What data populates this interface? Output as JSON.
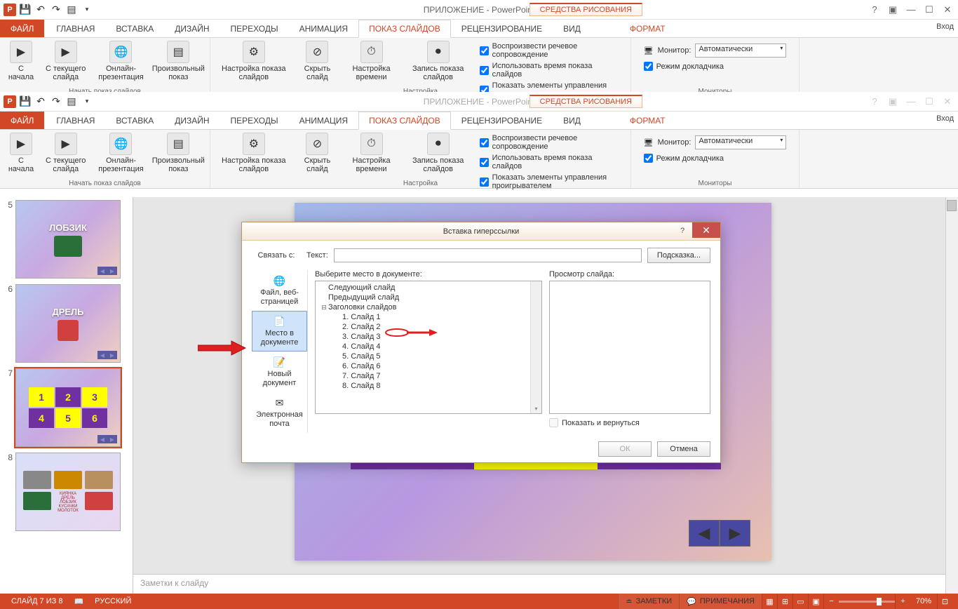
{
  "app_title": "ПРИЛОЖЕНИЕ  - PowerPoint",
  "drawing_tools": "СРЕДСТВА РИСОВАНИЯ",
  "sign_in": "Вход",
  "tabs": {
    "file": "ФАЙЛ",
    "home": "ГЛАВНАЯ",
    "insert": "ВСТАВКА",
    "design": "ДИЗАЙН",
    "transitions": "ПЕРЕХОДЫ",
    "animations": "АНИМАЦИЯ",
    "slideshow": "ПОКАЗ СЛАЙДОВ",
    "review": "РЕЦЕНЗИРОВАНИЕ",
    "view": "ВИД",
    "format": "ФОРМАТ"
  },
  "ribbon": {
    "from_start": "С начала",
    "from_current": "С текущего слайда",
    "online": "Онлайн-презентация",
    "custom": "Произвольный показ",
    "group_start": "Начать показ слайдов",
    "setup": "Настройка показа слайдов",
    "hide": "Скрыть слайд",
    "timing": "Настройка времени",
    "record": "Запись показа слайдов",
    "chk_narration": "Воспроизвести речевое сопровождение",
    "chk_timings": "Использовать время показа слайдов",
    "chk_controls": "Показать элементы управления проигрывателем",
    "group_setup": "Настройка",
    "monitor_label": "Монитор:",
    "monitor_value": "Автоматически",
    "presenter_view": "Режим докладчика",
    "group_monitors": "Мониторы"
  },
  "thumbs": {
    "n5": "5",
    "t5": "ЛОБЗИК",
    "n6": "6",
    "t6": "ДРЕЛЬ",
    "n7": "7",
    "n8": "8",
    "grid": [
      "1",
      "2",
      "3",
      "4",
      "5",
      "6"
    ]
  },
  "notes_placeholder": "Заметки к слайду",
  "dialog": {
    "title": "Вставка гиперссылки",
    "link_to": "Связать с:",
    "text_label": "Текст:",
    "hint_btn": "Подсказка...",
    "left": {
      "file": "Файл, веб-страницей",
      "place": "Место в документе",
      "new": "Новый документ",
      "email": "Электронная почта"
    },
    "select_label": "Выберите место в документе:",
    "preview_label": "Просмотр слайда:",
    "tree": {
      "next": "Следующий слайд",
      "prev": "Предыдущий слайд",
      "titles": "Заголовки слайдов",
      "s1": "1. Слайд 1",
      "s2": "2. Слайд 2",
      "s3": "3. Слайд 3",
      "s4": "4. Слайд 4",
      "s5": "5. Слайд 5",
      "s6": "6. Слайд 6",
      "s7": "7. Слайд 7",
      "s8": "8. Слайд 8"
    },
    "show_return": "Показать и вернуться",
    "ok": "ОК",
    "cancel": "Отмена"
  },
  "status": {
    "slide": "СЛАЙД 7 ИЗ 8",
    "lang": "РУССКИЙ",
    "notes": "ЗАМЕТКИ",
    "comments": "ПРИМЕЧАНИЯ",
    "zoom": "70%"
  }
}
